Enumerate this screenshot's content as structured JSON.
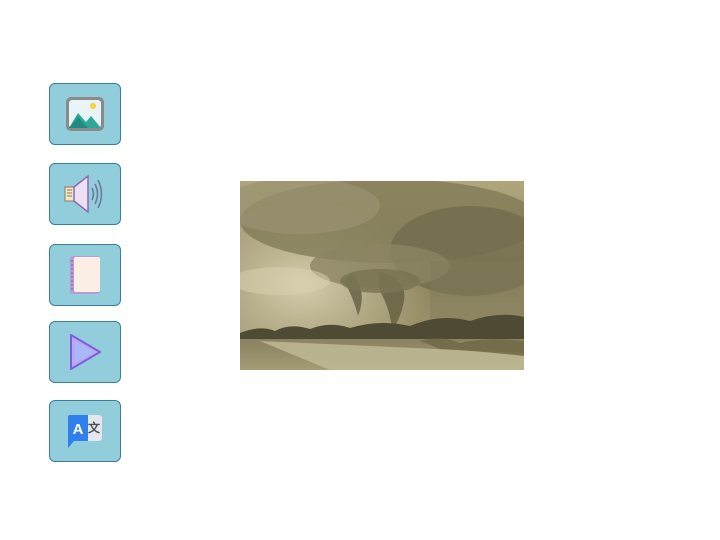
{
  "toolbar": {
    "buttons": [
      {
        "id": "image",
        "icon": "image-icon"
      },
      {
        "id": "audio",
        "icon": "speaker-icon"
      },
      {
        "id": "book",
        "icon": "notebook-icon"
      },
      {
        "id": "play",
        "icon": "play-icon"
      },
      {
        "id": "translate",
        "icon": "translate-icon",
        "glyphs": [
          "A",
          "文"
        ]
      }
    ],
    "button_color": "#92cddc",
    "border_color": "#3a7f96"
  },
  "main": {
    "photo": {
      "subject": "tornado-photo",
      "tone": "#b3a77a"
    }
  }
}
